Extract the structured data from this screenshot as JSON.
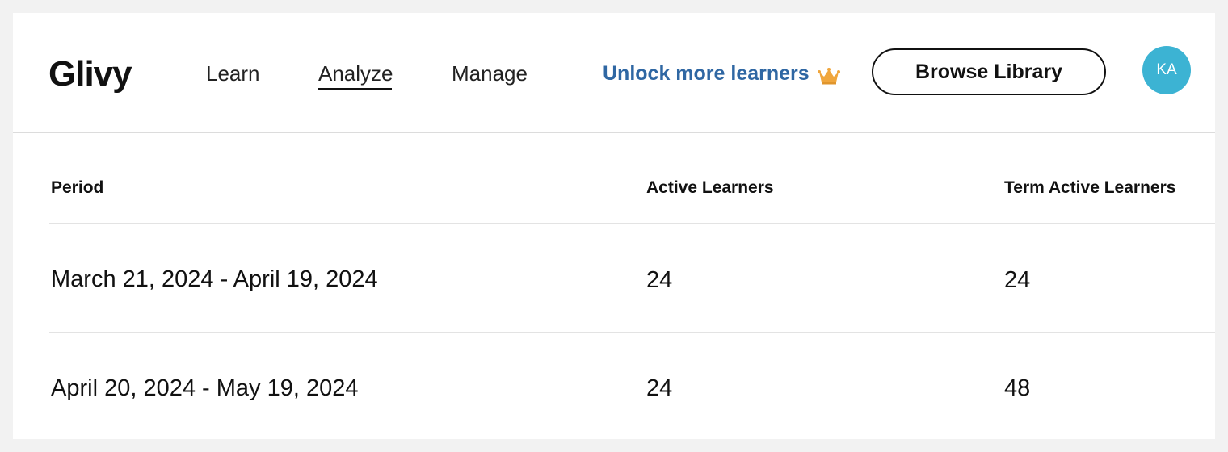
{
  "header": {
    "logo": "Glivy",
    "nav": [
      {
        "label": "Learn"
      },
      {
        "label": "Analyze"
      },
      {
        "label": "Manage"
      }
    ],
    "active_nav": "Analyze",
    "unlock_label": "Unlock more learners",
    "unlock_icon": "crown-icon",
    "browse_label": "Browse Library",
    "avatar_initials": "KA"
  },
  "colors": {
    "accent_link": "#2f67a3",
    "avatar_bg": "#3cb3d3",
    "crown": "#f0a63c"
  },
  "table": {
    "columns": [
      "Period",
      "Active Learners",
      "Term Active Learners"
    ],
    "rows": [
      {
        "period": "March 21, 2024 - April 19, 2024",
        "active": "24",
        "term_active": "24"
      },
      {
        "period": "April 20, 2024 - May 19, 2024",
        "active": "24",
        "term_active": "48"
      }
    ]
  }
}
